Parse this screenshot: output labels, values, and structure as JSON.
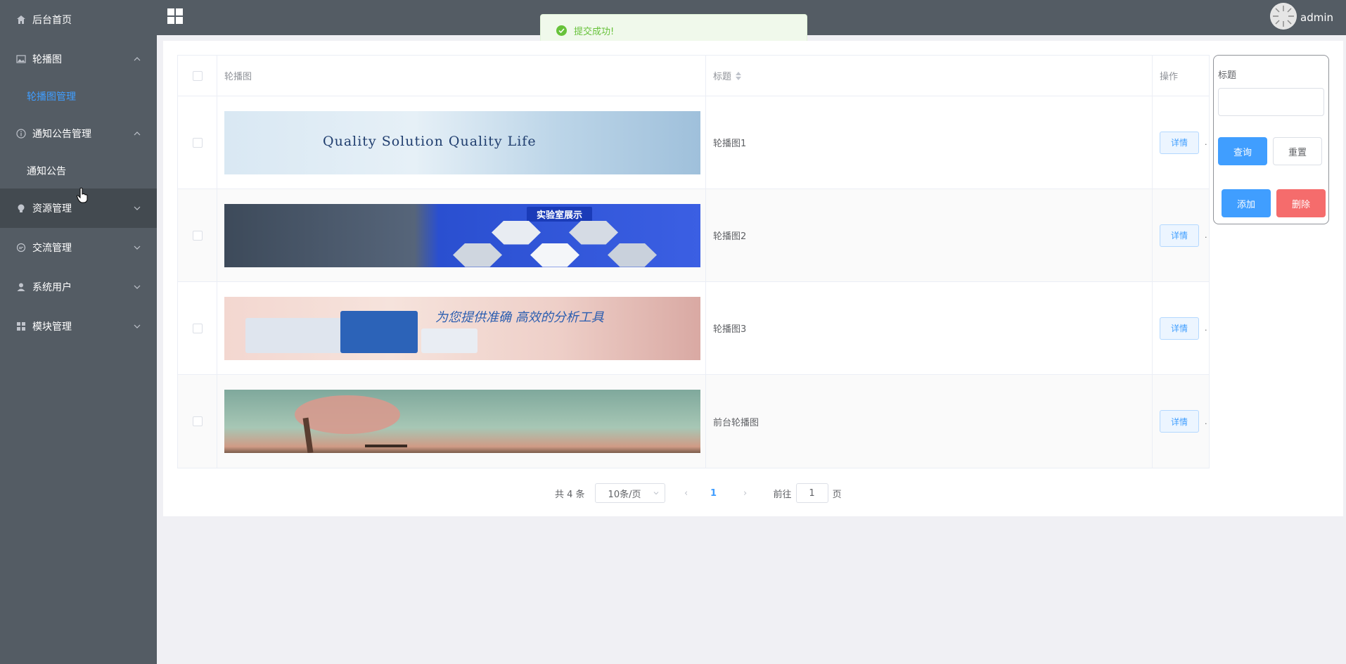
{
  "sidebar": {
    "items": [
      {
        "label": "后台首页",
        "icon": "home-icon"
      },
      {
        "label": "轮播图",
        "icon": "picture-icon",
        "expanded": true
      },
      {
        "label": "轮播图管理",
        "sub": true,
        "active": true
      },
      {
        "label": "通知公告管理",
        "icon": "info-icon",
        "expanded": true
      },
      {
        "label": "通知公告",
        "sub": true
      },
      {
        "label": "资源管理",
        "icon": "bulb-icon"
      },
      {
        "label": "交流管理",
        "icon": "chat-icon"
      },
      {
        "label": "系统用户",
        "icon": "user-icon"
      },
      {
        "label": "模块管理",
        "icon": "grid-icon"
      }
    ]
  },
  "header": {
    "title": "",
    "username": "admin"
  },
  "toast": {
    "message": "提交成功!"
  },
  "table": {
    "columns": {
      "image": "轮播图",
      "title": "标题",
      "op": "操作"
    },
    "rows": [
      {
        "title": "轮播图1",
        "banner_text": "Quality Solution   Quality Life",
        "detail": "详情"
      },
      {
        "title": "轮播图2",
        "banner_text": "实验室展示",
        "detail": "详情"
      },
      {
        "title": "轮播图3",
        "banner_text": "为您提供准确 高效的分析工具",
        "detail": "详情"
      },
      {
        "title": "前台轮播图",
        "banner_text": "",
        "detail": "详情"
      }
    ]
  },
  "pagination": {
    "total": "共 4 条",
    "page_size": "10条/页",
    "current": "1",
    "goto_label": "前往",
    "goto_value": "1",
    "page_suffix": "页"
  },
  "search": {
    "label": "标题",
    "query": "查询",
    "reset": "重置",
    "add": "添加",
    "delete": "删除"
  },
  "colors": {
    "sidebar_bg": "#545c64",
    "accent": "#409eff",
    "danger": "#f56c6c",
    "success": "#67c23a"
  }
}
